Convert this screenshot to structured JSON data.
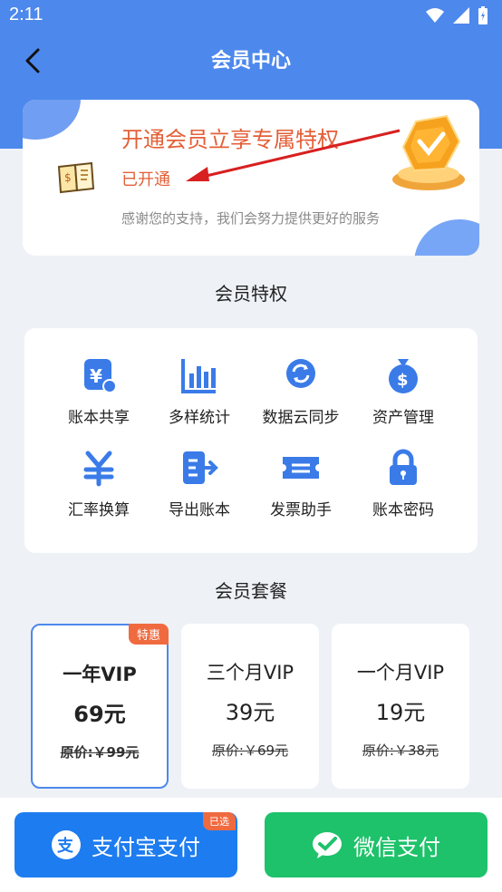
{
  "status_bar": {
    "time": "2:11"
  },
  "header": {
    "title": "会员中心"
  },
  "vip_card": {
    "headline": "开通会员立享专属特权",
    "status": "已开通",
    "thanks": "感谢您的支持，我们会努力提供更好的服务"
  },
  "features": {
    "title": "会员特权",
    "items": [
      {
        "label": "账本共享",
        "icon": "shared-ledger-icon"
      },
      {
        "label": "多样统计",
        "icon": "bar-chart-icon"
      },
      {
        "label": "数据云同步",
        "icon": "cloud-sync-icon"
      },
      {
        "label": "资产管理",
        "icon": "money-bag-icon"
      },
      {
        "label": "汇率换算",
        "icon": "currency-exchange-icon"
      },
      {
        "label": "导出账本",
        "icon": "export-icon"
      },
      {
        "label": "发票助手",
        "icon": "ticket-icon"
      },
      {
        "label": "账本密码",
        "icon": "lock-icon"
      }
    ]
  },
  "plans": {
    "title": "会员套餐",
    "items": [
      {
        "name": "一年VIP",
        "price": "69元",
        "original": "原价:￥99元",
        "tag": "特惠",
        "selected": true
      },
      {
        "name": "三个月VIP",
        "price": "39元",
        "original": "原价:￥69元",
        "selected": false
      },
      {
        "name": "一个月VIP",
        "price": "19元",
        "original": "原价:￥38元",
        "selected": false
      }
    ]
  },
  "payment": {
    "alipay_label": "支付宝支付",
    "alipay_badge": "已选",
    "wechat_label": "微信支付"
  },
  "colors": {
    "primary": "#4d88ec",
    "accent": "#e35f37",
    "alipay": "#1d7cf0",
    "wechat": "#1ec26a",
    "tag": "#f06a3f"
  }
}
